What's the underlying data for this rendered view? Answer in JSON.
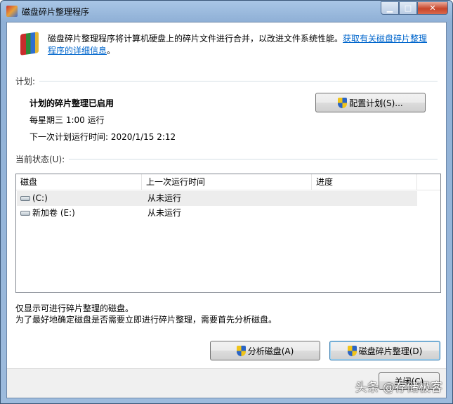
{
  "window": {
    "title": "磁盘碎片整理程序",
    "controls": [
      "minimize",
      "maximize",
      "close"
    ]
  },
  "description": {
    "text": "磁盘碎片整理程序将计算机硬盘上的碎片文件进行合并，以改进文件系统性能。",
    "link": "获取有关磁盘碎片整理程序的详细信息",
    "suffix": "。"
  },
  "schedule": {
    "heading": "计划:",
    "status": "计划的碎片整理已启用",
    "frequency": "每星期三  1:00 运行",
    "next_run": "下一次计划运行时间: 2020/1/15 2:12",
    "configure_button": "配置计划(S)..."
  },
  "current_status": {
    "heading": "当前状态(U):",
    "columns": [
      "磁盘",
      "上一次运行时间",
      "进度"
    ],
    "rows": [
      {
        "disk": "(C:)",
        "last_run": "从未运行",
        "progress": "",
        "selected": true
      },
      {
        "disk": "新加卷 (E:)",
        "last_run": "从未运行",
        "progress": "",
        "selected": false
      }
    ]
  },
  "notes": [
    "仅显示可进行碎片整理的磁盘。",
    "为了最好地确定磁盘是否需要立即进行碎片整理，需要首先分析磁盘。"
  ],
  "buttons": {
    "analyze": "分析磁盘(A)",
    "defragment": "磁盘碎片整理(D)",
    "close": "关闭(C)"
  },
  "watermark": "头条 @存储极客"
}
